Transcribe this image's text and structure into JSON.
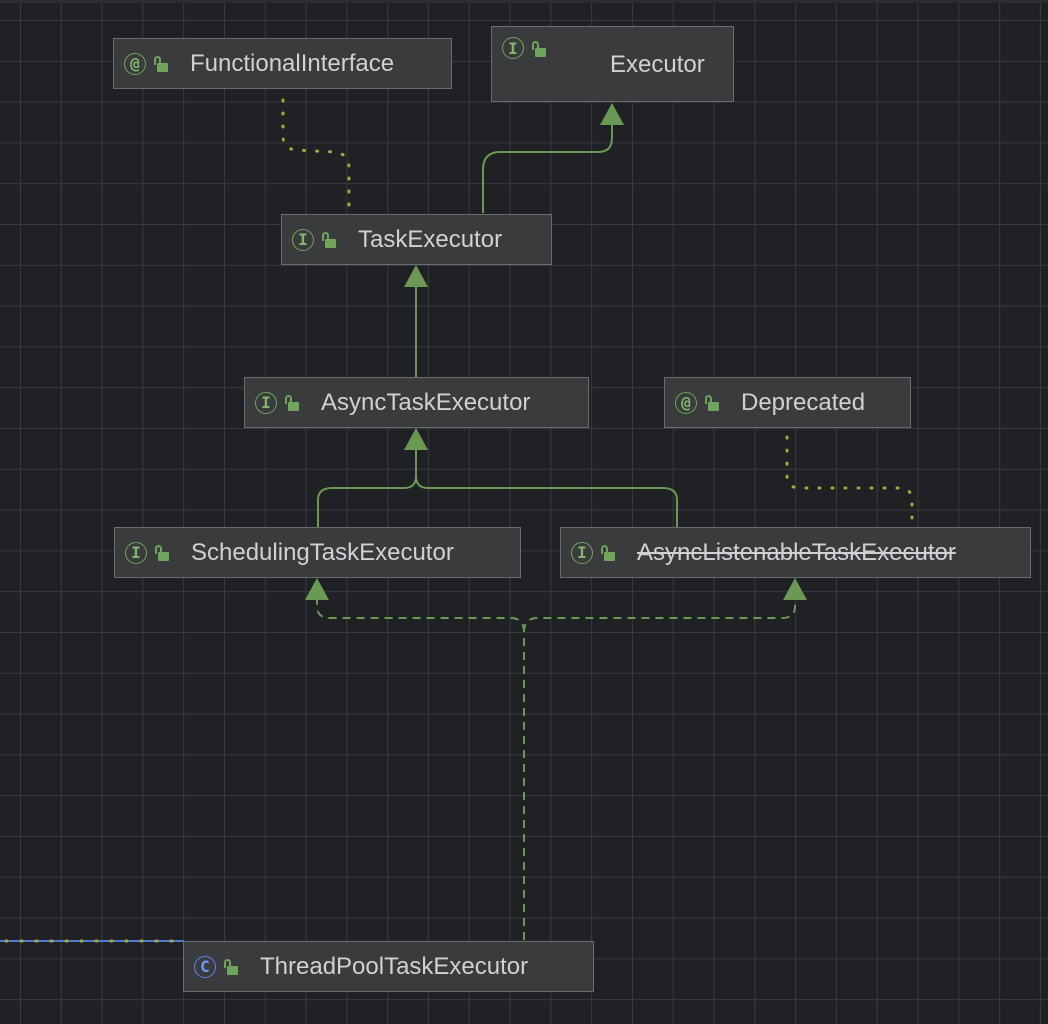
{
  "nodes": [
    {
      "id": "functional-interface",
      "kind": "annotation",
      "badge": "@",
      "name": "FunctionalInterface",
      "deprecated": false
    },
    {
      "id": "executor",
      "kind": "interface",
      "badge": "I",
      "name": "Executor",
      "deprecated": false
    },
    {
      "id": "task-executor",
      "kind": "interface",
      "badge": "I",
      "name": "TaskExecutor",
      "deprecated": false
    },
    {
      "id": "async-task-executor",
      "kind": "interface",
      "badge": "I",
      "name": "AsyncTaskExecutor",
      "deprecated": false
    },
    {
      "id": "deprecated",
      "kind": "annotation",
      "badge": "@",
      "name": "Deprecated",
      "deprecated": false
    },
    {
      "id": "scheduling-task-executor",
      "kind": "interface",
      "badge": "I",
      "name": "SchedulingTaskExecutor",
      "deprecated": false
    },
    {
      "id": "async-listenable-task-executor",
      "kind": "interface",
      "badge": "I",
      "name": "AsyncListenableTaskExecutor",
      "deprecated": true
    },
    {
      "id": "thread-pool-task-executor",
      "kind": "class",
      "badge": "C",
      "name": "ThreadPoolTaskExecutor",
      "deprecated": false
    }
  ],
  "edges": [
    {
      "from": "task-executor",
      "to": "executor",
      "type": "extends"
    },
    {
      "from": "task-executor",
      "to": "functional-interface",
      "type": "annotated"
    },
    {
      "from": "async-task-executor",
      "to": "task-executor",
      "type": "extends"
    },
    {
      "from": "scheduling-task-executor",
      "to": "async-task-executor",
      "type": "extends"
    },
    {
      "from": "async-listenable-task-executor",
      "to": "async-task-executor",
      "type": "extends"
    },
    {
      "from": "async-listenable-task-executor",
      "to": "deprecated",
      "type": "annotated"
    },
    {
      "from": "thread-pool-task-executor",
      "to": "scheduling-task-executor",
      "type": "implements"
    },
    {
      "from": "thread-pool-task-executor",
      "to": "async-listenable-task-executor",
      "type": "implements"
    }
  ],
  "colors": {
    "background": "#1f2124",
    "node_fill": "#3a3b3d",
    "node_border": "#696c71",
    "text": "#cfd1d4",
    "interface_badge": "#6fa55c",
    "class_badge": "#5b84f0",
    "extends_edge": "#6a9955",
    "annotation_edge": "#a8a83a",
    "offpage_edge": "#4f7bd6"
  }
}
